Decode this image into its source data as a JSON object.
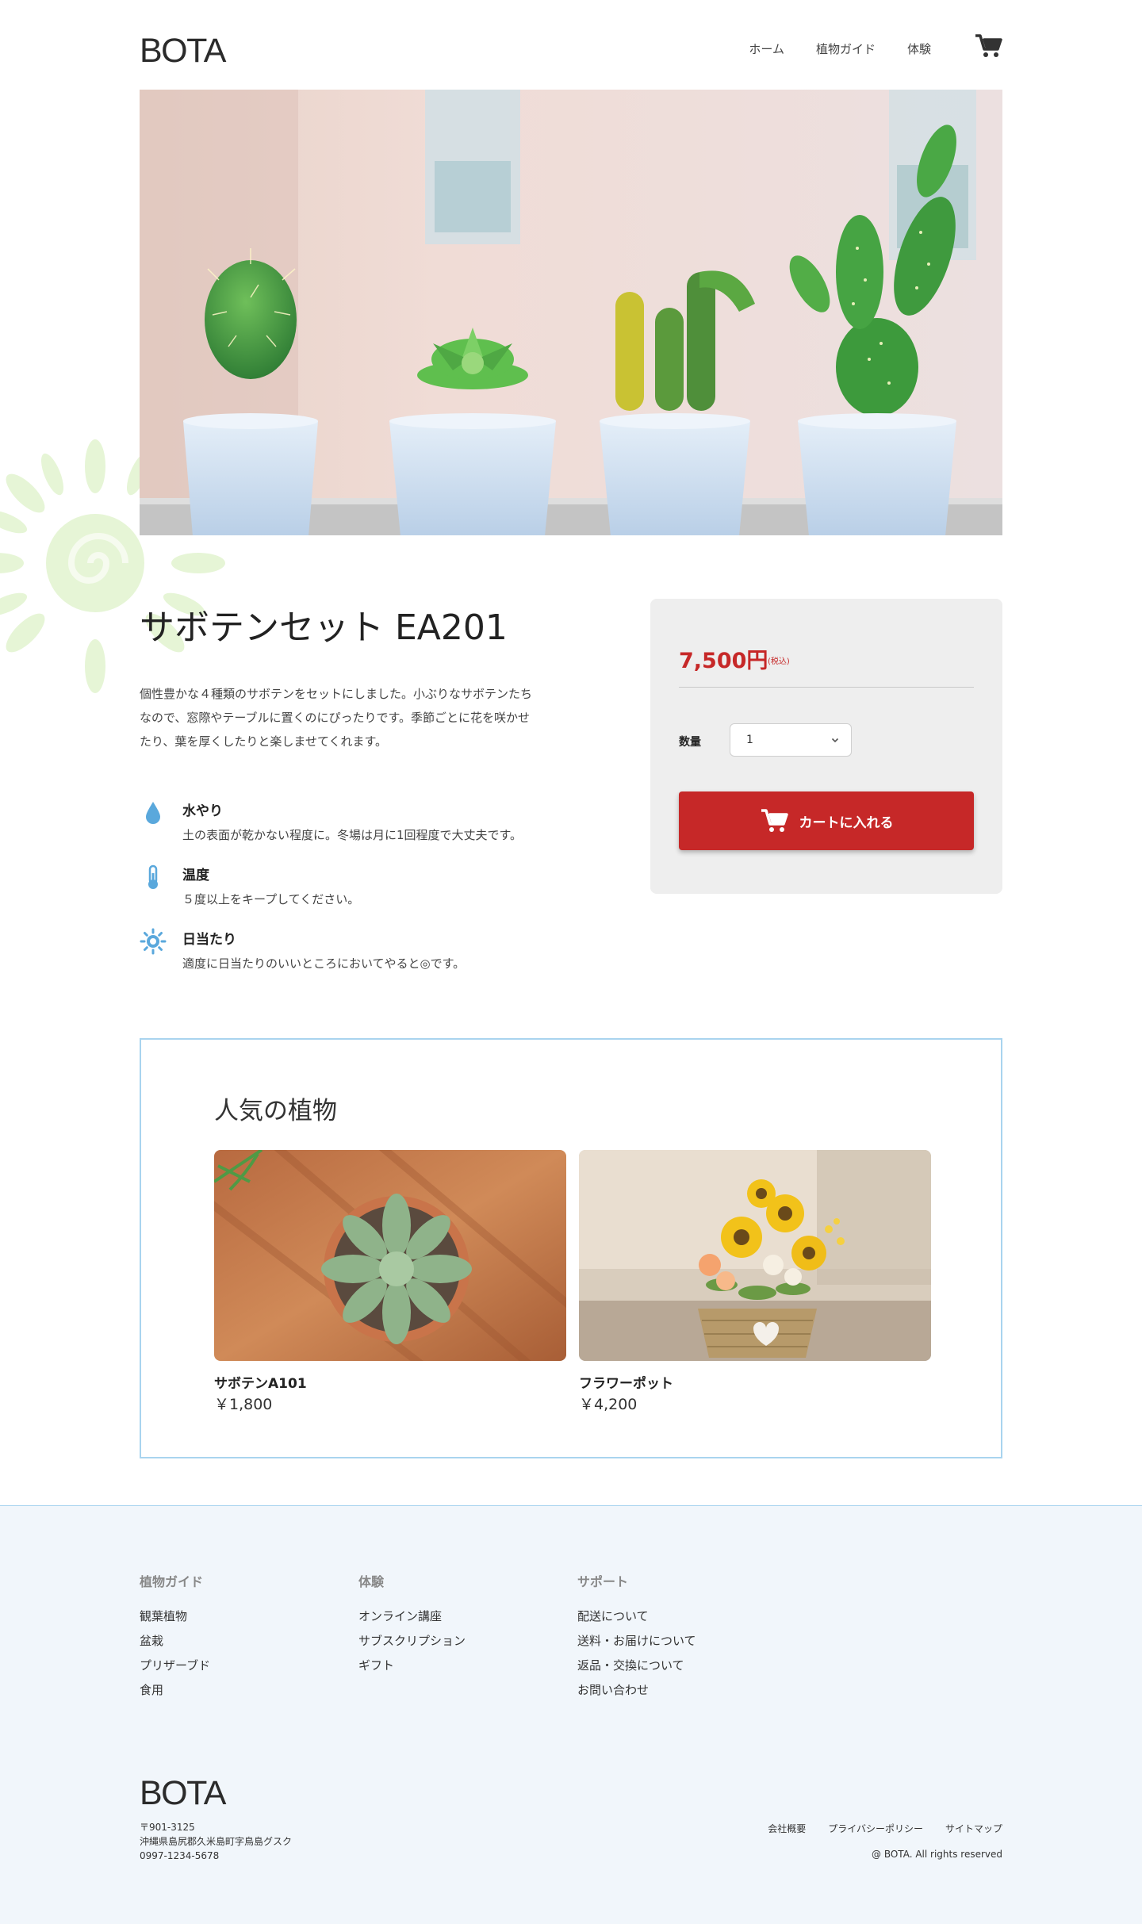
{
  "header": {
    "logo": "BOTA",
    "nav": [
      "ホーム",
      "植物ガイド",
      "体験"
    ]
  },
  "product": {
    "title": "サボテンセット EA201",
    "description_lines": [
      "個性豊かな４種類のサボテンをセットにしました。小ぶりなサボテンたち",
      "なので、窓際やテーブルに置くのにぴったりです。季節ごとに花を咲かせ",
      "たり、葉を厚くしたりと楽しませてくれます。"
    ],
    "care": [
      {
        "title": "水やり",
        "text": "土の表面が乾かない程度に。冬場は月に1回程度で大丈夫です。",
        "icon": "water-drop-icon"
      },
      {
        "title": "温度",
        "text": "５度以上をキープしてください。",
        "icon": "thermometer-icon"
      },
      {
        "title": "日当たり",
        "text": "適度に日当たりのいいところにおいてやると◎です。",
        "icon": "sun-icon"
      }
    ]
  },
  "purchase": {
    "price": "7,500円",
    "price_note": "(税込)",
    "quantity_label": "数量",
    "quantity_value": "1",
    "cart_button_label": "カートに入れる",
    "accent_color": "#c62828"
  },
  "popular": {
    "title": "人気の植物",
    "items": [
      {
        "name": "サボテンA101",
        "price": "￥1,800"
      },
      {
        "name": "フラワーポット",
        "price": "￥4,200"
      }
    ]
  },
  "footer": {
    "columns": [
      {
        "heading": "植物ガイド",
        "links": [
          "観葉植物",
          "盆栽",
          "プリザーブド",
          "食用"
        ]
      },
      {
        "heading": "体験",
        "links": [
          "オンライン講座",
          "サブスクリプション",
          "ギフト"
        ]
      },
      {
        "heading": "サポート",
        "links": [
          "配送について",
          "送料・お届けについて",
          "返品・交換について",
          "お問い合わせ"
        ]
      }
    ],
    "logo": "BOTA",
    "address_lines": [
      "〒901-3125",
      "沖縄県島尻郡久米島町字鳥島グスク",
      "0997-1234-5678"
    ],
    "legal_links": [
      "会社概要",
      "プライバシーポリシー",
      "サイトマップ"
    ],
    "copyright": "@ BOTA. All rights reserved"
  }
}
